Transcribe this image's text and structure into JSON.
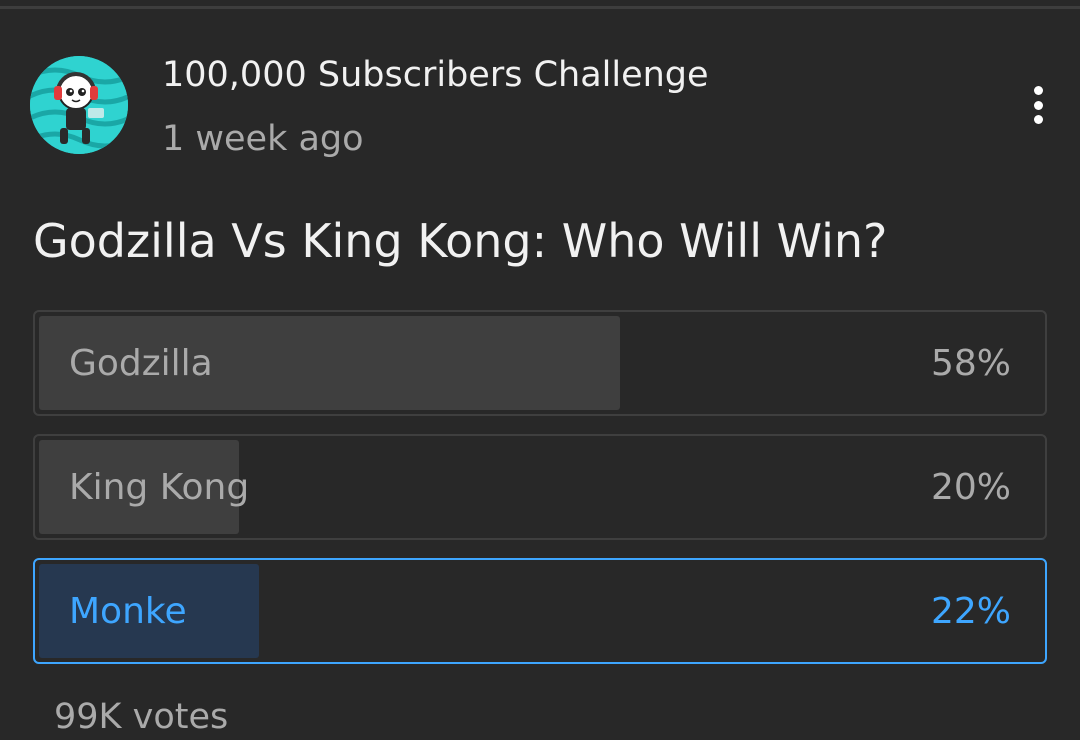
{
  "post": {
    "channel_name": "100,000 Subscribers Challenge",
    "time_posted": "1 week ago",
    "menu_icon": "more-vertical-icon",
    "avatar_icon": "channel-avatar"
  },
  "poll": {
    "question": "Godzilla Vs King Kong: Who Will Win?",
    "options": [
      {
        "label": "Godzilla",
        "percent_text": "58%",
        "share": 0.58,
        "selected": false
      },
      {
        "label": "King Kong",
        "percent_text": "20%",
        "share": 0.2,
        "selected": false
      },
      {
        "label": "Monke",
        "percent_text": "22%",
        "share": 0.22,
        "selected": true
      }
    ],
    "votes": "99K votes"
  },
  "colors": {
    "background": "#282828",
    "option_fill": "#3f3f3f",
    "selected_accent": "#3ea6ff",
    "selected_fill": "#263850",
    "text_primary": "#f1f1f1",
    "text_secondary": "#aaaaaa"
  }
}
